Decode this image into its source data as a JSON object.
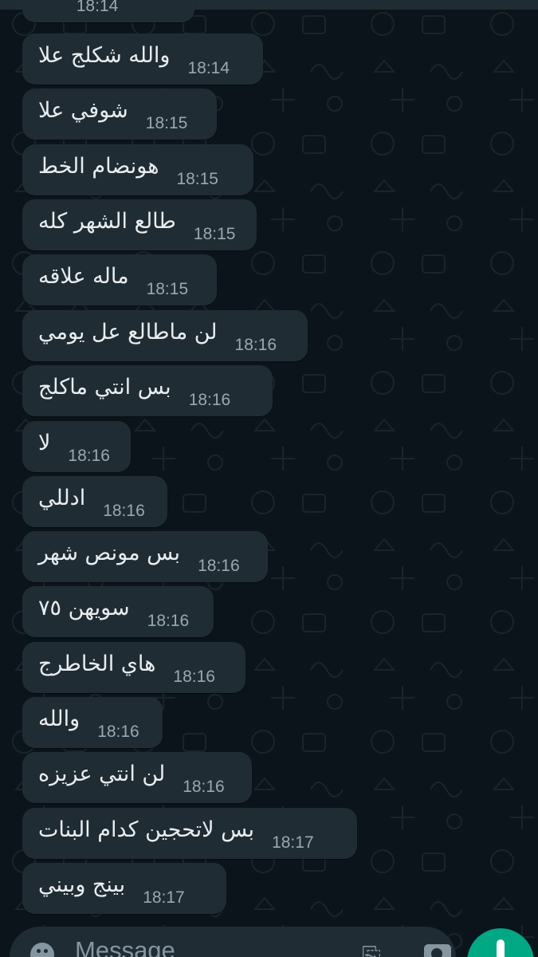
{
  "chat": {
    "partial_message": {
      "text": "...",
      "time": "18:14"
    },
    "messages": [
      {
        "text": "والله شكلج علا",
        "time": "18:14"
      },
      {
        "text": "شوفي علا",
        "time": "18:15"
      },
      {
        "text": "هونضام الخط",
        "time": "18:15"
      },
      {
        "text": "طالع الشهر كله",
        "time": "18:15"
      },
      {
        "text": "ماله علاقه",
        "time": "18:15"
      },
      {
        "text": "لن ماطالع عل يومي",
        "time": "18:16"
      },
      {
        "text": "بس انتي ماكلج",
        "time": "18:16"
      },
      {
        "text": "لا",
        "time": "18:16"
      },
      {
        "text": "ادللي",
        "time": "18:16"
      },
      {
        "text": "بس مونص شهر",
        "time": "18:16"
      },
      {
        "text": "سويهن ٧٥",
        "time": "18:16"
      },
      {
        "text": "هاي الخاطرج",
        "time": "18:16"
      },
      {
        "text": "والله",
        "time": "18:16"
      },
      {
        "text": "لن انتي عزيزه",
        "time": "18:16"
      },
      {
        "text": "بس لاتحجين كدام البنات",
        "time": "18:17"
      },
      {
        "text": "بينج وبيني",
        "time": "18:17"
      }
    ]
  },
  "composer": {
    "placeholder": "Message",
    "emoji_icon": "emoji-icon",
    "attach_icon": "attach-icon",
    "camera_icon": "camera-icon",
    "mic_icon": "mic-icon"
  },
  "colors": {
    "background": "#0b141a",
    "bubble": "#202c33",
    "text": "#e9edef",
    "timestamp": "#9aa8b0",
    "accent": "#00a884"
  }
}
